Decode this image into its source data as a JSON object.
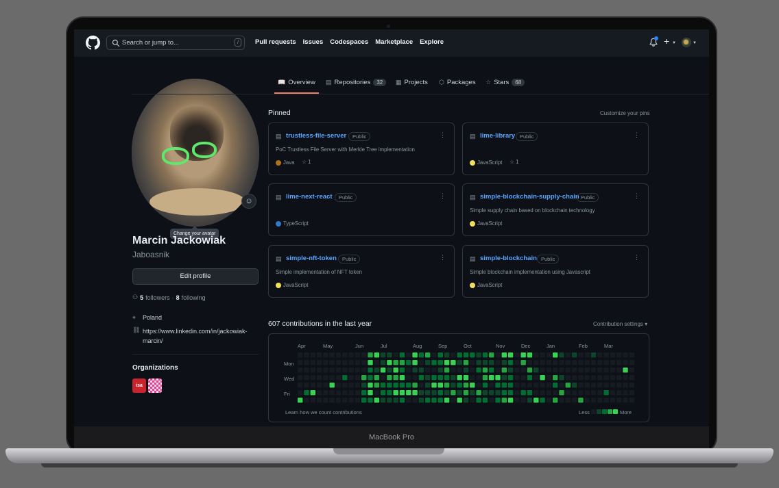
{
  "device": {
    "label": "MacBook Pro"
  },
  "header": {
    "search_placeholder": "Search or jump to...",
    "search_key": "/",
    "nav": [
      "Pull requests",
      "Issues",
      "Codespaces",
      "Marketplace",
      "Explore"
    ]
  },
  "profile": {
    "name": "Marcin Jackowiak",
    "login": "Jaboasnik",
    "avatar_tooltip": "Change your avatar",
    "edit_label": "Edit profile",
    "followers_count": "5",
    "followers_label": "followers",
    "following_count": "8",
    "following_label": "following",
    "location": "Poland",
    "link_line1": "https://www.linkedin.com/in/jackowiak-",
    "link_line2": "marcin/",
    "orgs_title": "Organizations",
    "org1_abbr": "isa"
  },
  "tabs": [
    {
      "label": "Overview",
      "count": null
    },
    {
      "label": "Repositories",
      "count": "32"
    },
    {
      "label": "Projects",
      "count": null
    },
    {
      "label": "Packages",
      "count": null
    },
    {
      "label": "Stars",
      "count": "68"
    }
  ],
  "pinned": {
    "title": "Pinned",
    "customize": "Customize your pins",
    "repos": [
      {
        "name": "trustless-file-server",
        "visibility": "Public",
        "desc": "PoC Trustless File Server with Merkle Tree implementation",
        "lang": "Java",
        "lang_color": "#b07219",
        "stars": "1"
      },
      {
        "name": "lime-library",
        "visibility": "Public",
        "desc": "",
        "lang": "JavaScript",
        "lang_color": "#f1e05a",
        "stars": "1"
      },
      {
        "name": "lime-next-react",
        "visibility": "Public",
        "desc": "",
        "lang": "TypeScript",
        "lang_color": "#3178c6",
        "stars": ""
      },
      {
        "name": "simple-blockchain-supply-chain",
        "visibility": "Public",
        "desc": "Simple supply chain based on blockchain technology",
        "lang": "JavaScript",
        "lang_color": "#f1e05a",
        "stars": ""
      },
      {
        "name": "simple-nft-token",
        "visibility": "Public",
        "desc": "Simple implementation of NFT token",
        "lang": "JavaScript",
        "lang_color": "#f1e05a",
        "stars": ""
      },
      {
        "name": "simple-blockchain",
        "visibility": "Public",
        "desc": "Simple blockchain implementation using Javascript",
        "lang": "JavaScript",
        "lang_color": "#f1e05a",
        "stars": ""
      }
    ]
  },
  "contributions": {
    "title": "607 contributions in the last year",
    "settings": "Contribution settings ▾",
    "months": [
      "Apr",
      "May",
      "Jun",
      "Jul",
      "Aug",
      "Sep",
      "Oct",
      "Nov",
      "Dec",
      "Jan",
      "Feb",
      "Mar"
    ],
    "days": [
      "Mon",
      "Wed",
      "Fri"
    ],
    "learn": "Learn how we count contributions",
    "less": "Less",
    "more": "More",
    "levels": [
      "#161b22",
      "#0e4429",
      "#006d32",
      "#26a641",
      "#39d353"
    ]
  }
}
